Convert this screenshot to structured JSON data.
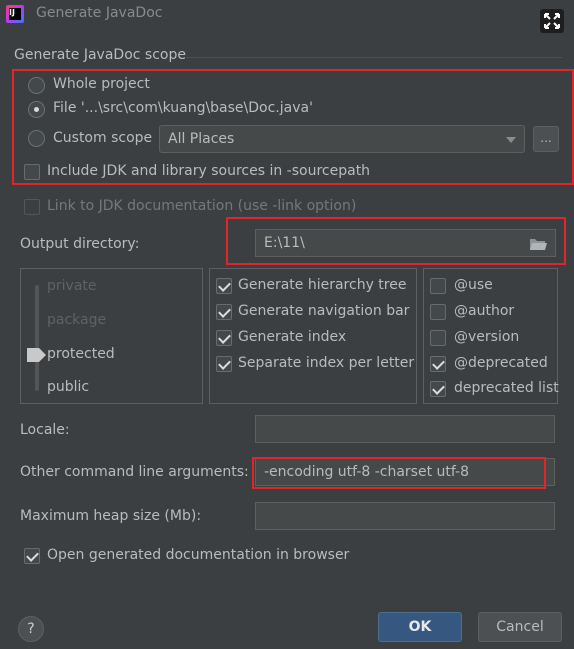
{
  "window": {
    "title": "Generate JavaDoc"
  },
  "scope": {
    "group_title": "Generate JavaDoc scope",
    "whole_project": "Whole project",
    "file": "File '...\\src\\com\\kuang\\base\\Doc.java'",
    "custom_scope": "Custom scope",
    "custom_scope_value": "All Places",
    "browse_label": "...",
    "include_jdk": "Include JDK and library sources in -sourcepath",
    "link_jdk": "Link to JDK documentation (use -link option)",
    "selected": "file"
  },
  "output": {
    "label": "Output directory:",
    "value": "E:\\11\\"
  },
  "visibility": {
    "levels": [
      "private",
      "package",
      "protected",
      "public"
    ],
    "selected": "protected"
  },
  "generate_options": [
    {
      "label": "Generate hierarchy tree",
      "checked": true
    },
    {
      "label": "Generate navigation bar",
      "checked": true
    },
    {
      "label": "Generate index",
      "checked": true
    },
    {
      "label": "Separate index per letter",
      "checked": true
    }
  ],
  "tag_options": [
    {
      "label": "@use",
      "checked": false
    },
    {
      "label": "@author",
      "checked": false
    },
    {
      "label": "@version",
      "checked": false
    },
    {
      "label": "@deprecated",
      "checked": true
    },
    {
      "label": "deprecated list",
      "checked": true
    }
  ],
  "locale": {
    "label": "Locale:",
    "value": ""
  },
  "other_args": {
    "label": "Other command line arguments:",
    "value": "-encoding utf-8 -charset utf-8"
  },
  "heap": {
    "label": "Maximum heap size (Mb):",
    "value": ""
  },
  "open_browser": {
    "label": "Open generated documentation in browser",
    "checked": true
  },
  "buttons": {
    "help": "?",
    "ok": "OK",
    "cancel": "Cancel"
  },
  "colors": {
    "background": "#3c3f41",
    "highlight": "#e0262b",
    "primary_button": "#365880"
  }
}
